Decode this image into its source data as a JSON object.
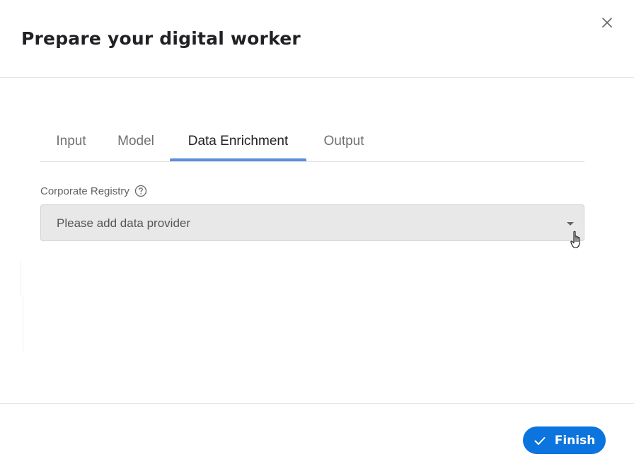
{
  "dialog": {
    "title": "Prepare your digital worker"
  },
  "tabs": [
    {
      "label": "Input",
      "active": false
    },
    {
      "label": "Model",
      "active": false
    },
    {
      "label": "Data Enrichment",
      "active": true
    },
    {
      "label": "Output",
      "active": false
    }
  ],
  "form": {
    "corporate_registry": {
      "label": "Corporate Registry",
      "value": "Please add data provider"
    }
  },
  "footer": {
    "finish_label": "Finish"
  },
  "icons": {
    "close": "close-icon",
    "help": "question-circle-icon",
    "caret": "caret-down-icon",
    "check": "check-icon",
    "cursor": "hand-pointer-cursor-icon"
  },
  "colors": {
    "accent": "#0b74de",
    "tab_underline": "#5b8fdb",
    "select_bg": "#e8e8e8"
  }
}
